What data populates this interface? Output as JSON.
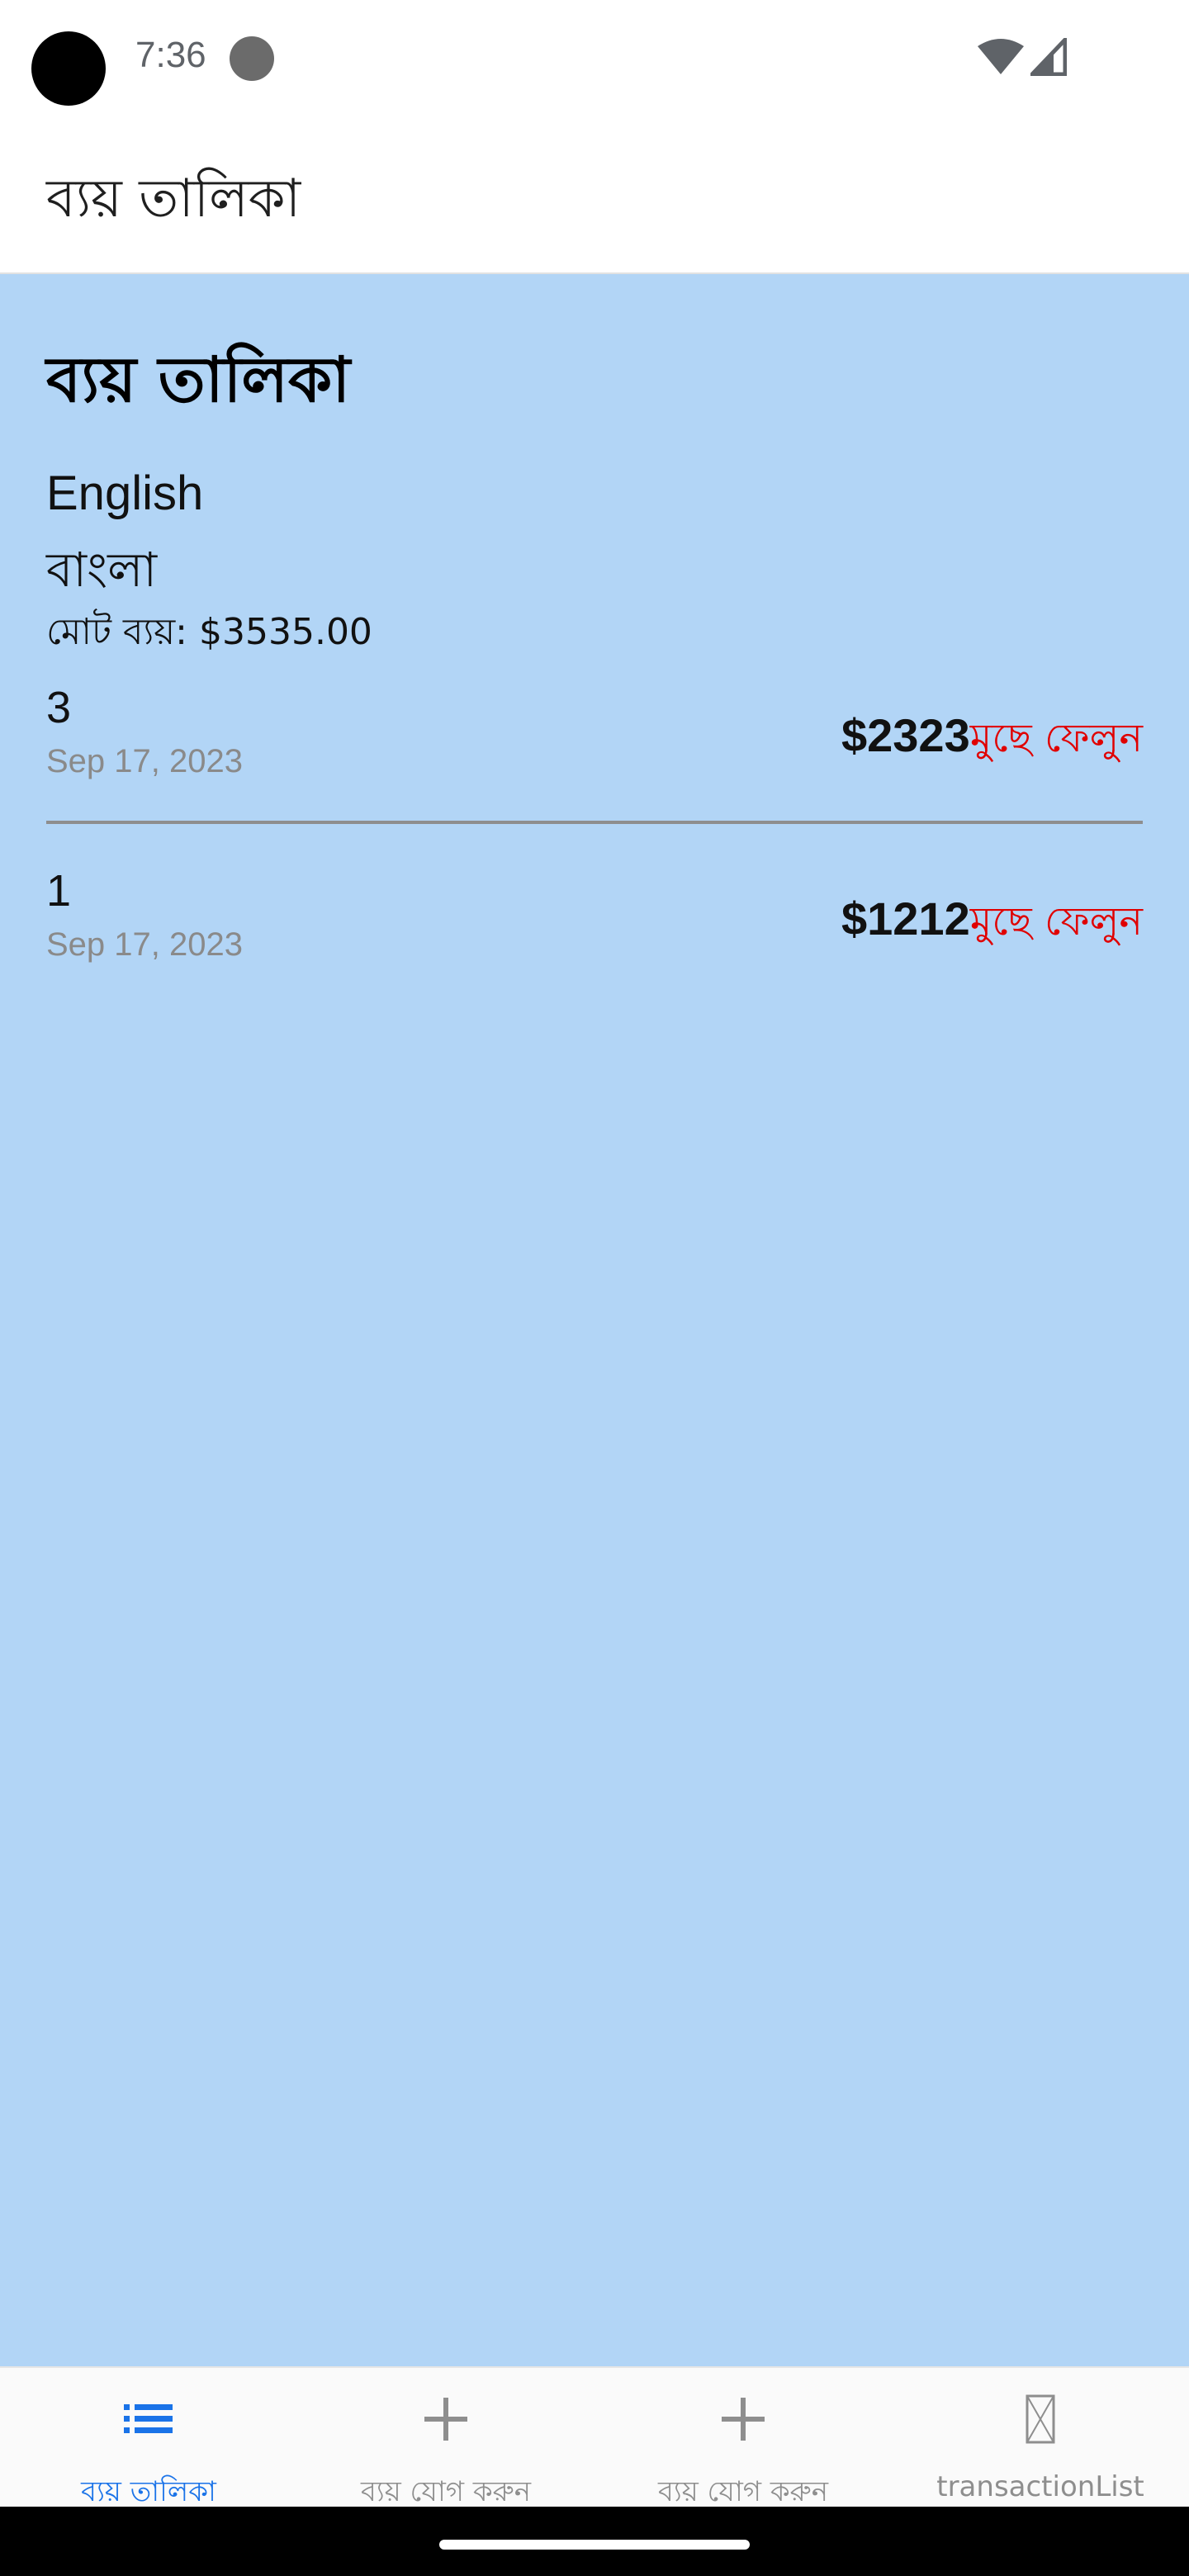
{
  "status_bar": {
    "time": "7:36"
  },
  "app_bar": {
    "title": "ব্যয় তালিকা"
  },
  "main": {
    "heading": "ব্যয় তালিকা",
    "languages": [
      "English",
      "বাংলা"
    ],
    "total_label": "মোট ব্যয়: $3535.00",
    "expenses": [
      {
        "name": "3",
        "date": "Sep 17, 2023",
        "amount": "$2323",
        "delete_label": "মুছে ফেলুন"
      },
      {
        "name": "1",
        "date": "Sep 17, 2023",
        "amount": "$1212",
        "delete_label": "মুছে ফেলুন"
      }
    ]
  },
  "bottom_nav": {
    "items": [
      {
        "label": "ব্যয় তালিকা",
        "icon": "list-icon",
        "active": true
      },
      {
        "label": "ব্যয় যোগ করুন",
        "icon": "plus-icon",
        "active": false
      },
      {
        "label": "ব্যয় যোগ করুন",
        "icon": "plus-icon",
        "active": false
      },
      {
        "label": "transactionList",
        "icon": "missing-image-icon",
        "active": false
      }
    ]
  },
  "colors": {
    "content_background": "#b2d5f6",
    "accent": "#1a73e8",
    "delete": "#e00000"
  }
}
